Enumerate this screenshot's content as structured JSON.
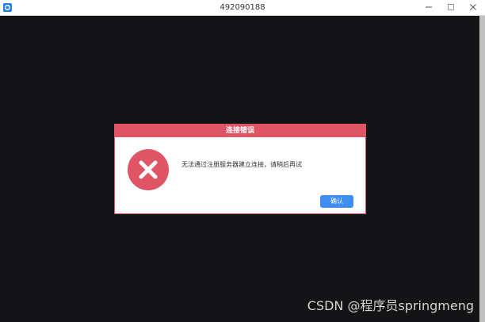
{
  "window": {
    "title": "492090188",
    "icons": {
      "app": "app-logo-icon",
      "minimize": "minimize-icon",
      "maximize": "maximize-icon",
      "close": "close-icon"
    }
  },
  "dialog": {
    "title": "连接错误",
    "message": "无法通过注册服务器建立连接，请稍后再试",
    "confirm_label": "确认",
    "icon": "error-x-icon"
  },
  "watermark": {
    "text": "CSDN @程序员springmeng"
  },
  "colors": {
    "accent_red": "#e05565",
    "button_blue": "#3d8ef0",
    "background": "#141316"
  }
}
